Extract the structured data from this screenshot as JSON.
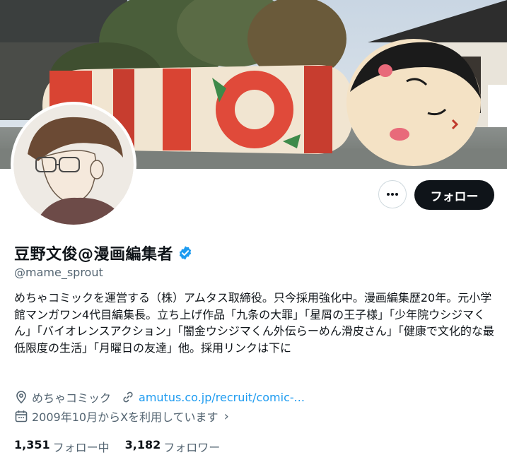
{
  "profile": {
    "display_name": "豆野文俊@漫画編集者",
    "handle": "@mame_sprout",
    "bio": "めちゃコミックを運営する（株）アムタス取締役。只今採用強化中。漫画編集歴20年。元小学館マンガワン4代目編集長。立ち上げ作品「九条の大罪」「星屑の王子様」「少年院ウシジマくん」「バイオレンスアクション」「闇金ウシジマくん外伝らーめん滑皮さん」「健康で文化的な最低限度の生活」「月曜日の友達」他。採用リンクは下に",
    "location": "めちゃコミック",
    "website": "amutus.co.jp/recruit/comic-...",
    "joined": "2009年10月からXを利用しています"
  },
  "actions": {
    "more_icon": "more-horizontal-icon",
    "follow_label": "フォロー"
  },
  "stats": {
    "following_count": "1,351",
    "following_label": "フォロー中",
    "followers_count": "3,182",
    "followers_label": "フォロワー"
  },
  "icons": {
    "verified": "verified-badge-icon",
    "location": "location-pin-icon",
    "link": "link-icon",
    "calendar": "calendar-icon"
  },
  "colors": {
    "accent": "#1d9bf0",
    "text": "#0f1419",
    "secondary": "#536471",
    "follow_bg": "#0f1419"
  }
}
